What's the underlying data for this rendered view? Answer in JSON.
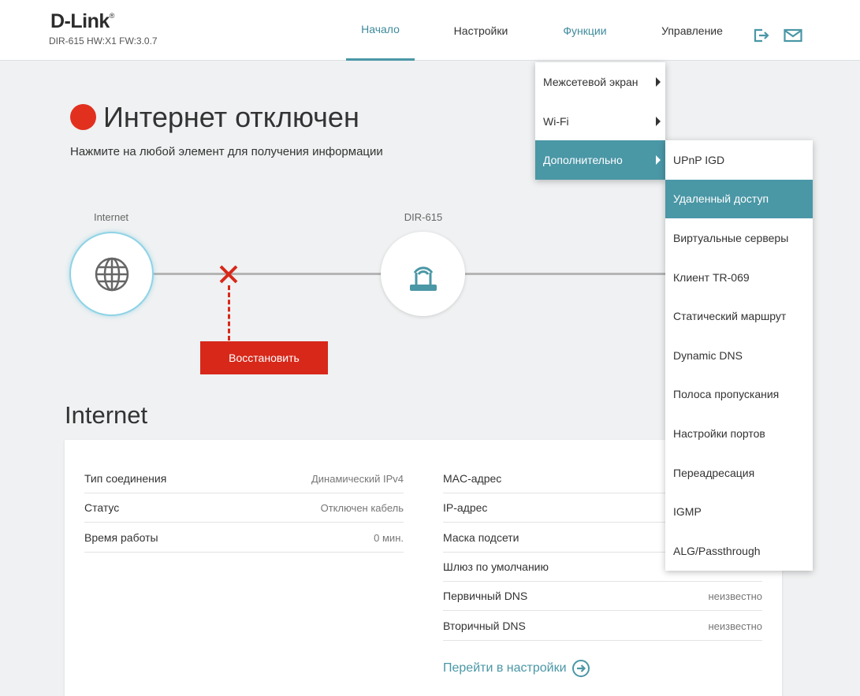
{
  "header": {
    "logo": "D-Link",
    "logo_reg": "®",
    "model": "DIR-615 HW:X1 FW:3.0.7",
    "nav": [
      "Начало",
      "Настройки",
      "Функции",
      "Управление"
    ],
    "logout_icon": "logout-icon",
    "mail_icon": "mail-icon"
  },
  "status": {
    "title": "Интернет отключен",
    "subtitle": "Нажмите на любой элемент для получения информации",
    "dot_color": "#e2301f"
  },
  "diagram": {
    "internet_label": "Internet",
    "router_label": "DIR-615",
    "restore_button": "Восстановить",
    "error_color": "#d7281a"
  },
  "internet": {
    "section_title": "Internet",
    "left": [
      {
        "key": "Тип соединения",
        "value": "Динамический IPv4"
      },
      {
        "key": "Статус",
        "value": "Отключен кабель"
      },
      {
        "key": "Время работы",
        "value": "0 мин."
      }
    ],
    "right": [
      {
        "key": "MAC-адрес",
        "value": ""
      },
      {
        "key": "IP-адрес",
        "value": ""
      },
      {
        "key": "Маска подсети",
        "value": ""
      },
      {
        "key": "Шлюз по умолчанию",
        "value": ""
      },
      {
        "key": "Первичный DNS",
        "value": "неизвестно"
      },
      {
        "key": "Вторичный DNS",
        "value": "неизвестно"
      }
    ],
    "goto_settings": "Перейти в настройки"
  },
  "menu_functions": {
    "items": [
      "Межсетевой экран",
      "Wi-Fi",
      "Дополнительно"
    ],
    "selected": "Дополнительно"
  },
  "menu_advanced": {
    "items": [
      "UPnP IGD",
      "Удаленный доступ",
      "Виртуальные серверы",
      "Клиент TR-069",
      "Статический маршрут",
      "Dynamic DNS",
      "Полоса пропускания",
      "Настройки портов",
      "Переадресация",
      "IGMP",
      "ALG/Passthrough"
    ],
    "selected": "Удаленный доступ"
  },
  "colors": {
    "accent": "#4a97a6",
    "background": "#eff1f2"
  }
}
